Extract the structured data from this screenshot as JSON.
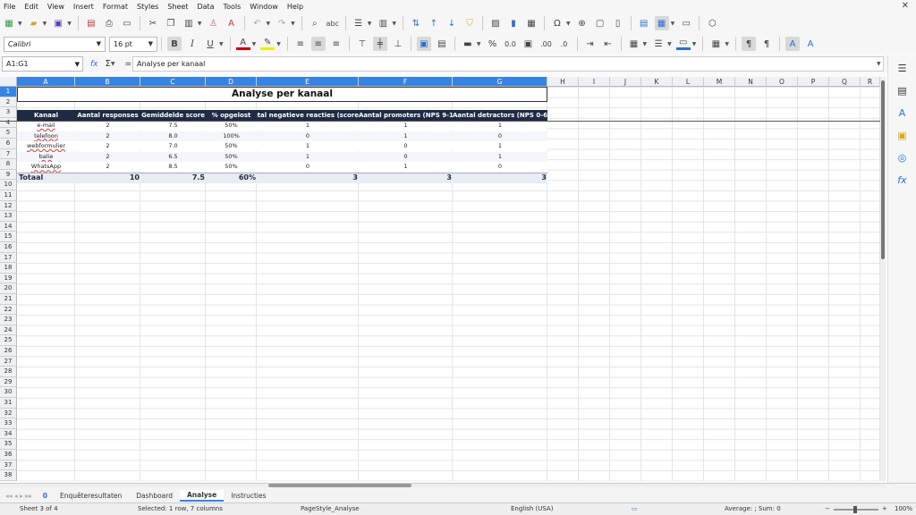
{
  "menu": [
    "File",
    "Edit",
    "View",
    "Insert",
    "Format",
    "Styles",
    "Sheet",
    "Data",
    "Tools",
    "Window",
    "Help"
  ],
  "font": {
    "name": "Calibri",
    "size": "16 pt"
  },
  "name_box": "A1:G1",
  "formula": "Analyse per kanaal",
  "columns": [
    "A",
    "B",
    "C",
    "D",
    "E",
    "F",
    "G",
    "H",
    "I",
    "J",
    "K",
    "L",
    "M",
    "N",
    "O",
    "P",
    "Q",
    "R"
  ],
  "rows": [
    "1",
    "2",
    "3",
    "4",
    "5",
    "6",
    "7",
    "8",
    "9",
    "10",
    "11",
    "12",
    "13",
    "14",
    "15",
    "16",
    "17",
    "18",
    "19",
    "20",
    "21",
    "22",
    "23",
    "24",
    "25",
    "26",
    "27",
    "28",
    "29",
    "30",
    "31",
    "32",
    "33",
    "34",
    "35",
    "36",
    "37",
    "38"
  ],
  "table": {
    "title": "Analyse per kanaal",
    "headers": [
      "Kanaal",
      "Aantal responses",
      "Gemiddelde score",
      "% opgelost",
      "antal negatieve reacties (score < ",
      "Aantal promoters (NPS 9-10)",
      "Aantal detractors (NPS 0-6)"
    ],
    "rows": [
      [
        "e-mail",
        "2",
        "7.5",
        "50%",
        "1",
        "1",
        "1"
      ],
      [
        "telefoon",
        "2",
        "8.0",
        "100%",
        "0",
        "1",
        "0"
      ],
      [
        "webformulier",
        "2",
        "7.0",
        "50%",
        "1",
        "0",
        "1"
      ],
      [
        "balie",
        "2",
        "6.5",
        "50%",
        "1",
        "0",
        "1"
      ],
      [
        "WhatsApp",
        "2",
        "8.5",
        "50%",
        "0",
        "1",
        "0"
      ]
    ],
    "total": [
      "Totaal",
      "10",
      "7.5",
      "60%",
      "3",
      "3",
      "3"
    ]
  },
  "sheets": [
    "0",
    "Enquêteresultaten",
    "Dashboard",
    "Analyse",
    "Instructies"
  ],
  "active_sheet": "Analyse",
  "status": {
    "sheet": "Sheet 3 of 4",
    "selection": "Selected: 1 row, 7 columns",
    "page_style": "PageStyle_Analyse",
    "language": "English (USA)",
    "summary": "Average: ; Sum: 0",
    "zoom": "100%"
  },
  "colors": {
    "header_bg": "#1f2a44",
    "selection": "#3584e4"
  }
}
